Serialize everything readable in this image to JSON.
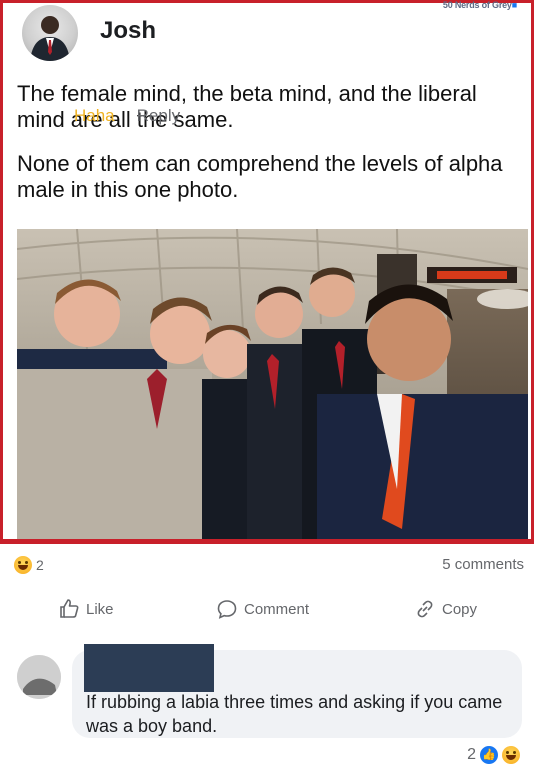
{
  "watermark": "50 Nerds of Grey",
  "post": {
    "author": "Josh",
    "text_lines": [
      "The female mind, the beta mind, and the liberal mind are all the same.",
      "None of them can comprehend the levels of alpha male in this one photo."
    ],
    "reaction_count": "2",
    "reaction_icon": "haha-emoji-icon",
    "comments_count": "5 comments"
  },
  "actions": {
    "like": "Like",
    "comment": "Comment",
    "copy": "Copy"
  },
  "comment": {
    "text": "If rubbing a labia three times and asking if you came was a boy band.",
    "haha": "Haha",
    "reply": "Reply",
    "reaction_count": "2"
  },
  "colors": {
    "frame": "#c8202a",
    "facebook_blue": "#1877f2",
    "secondary_text": "#65676b",
    "bubble_bg": "#f0f2f5"
  }
}
